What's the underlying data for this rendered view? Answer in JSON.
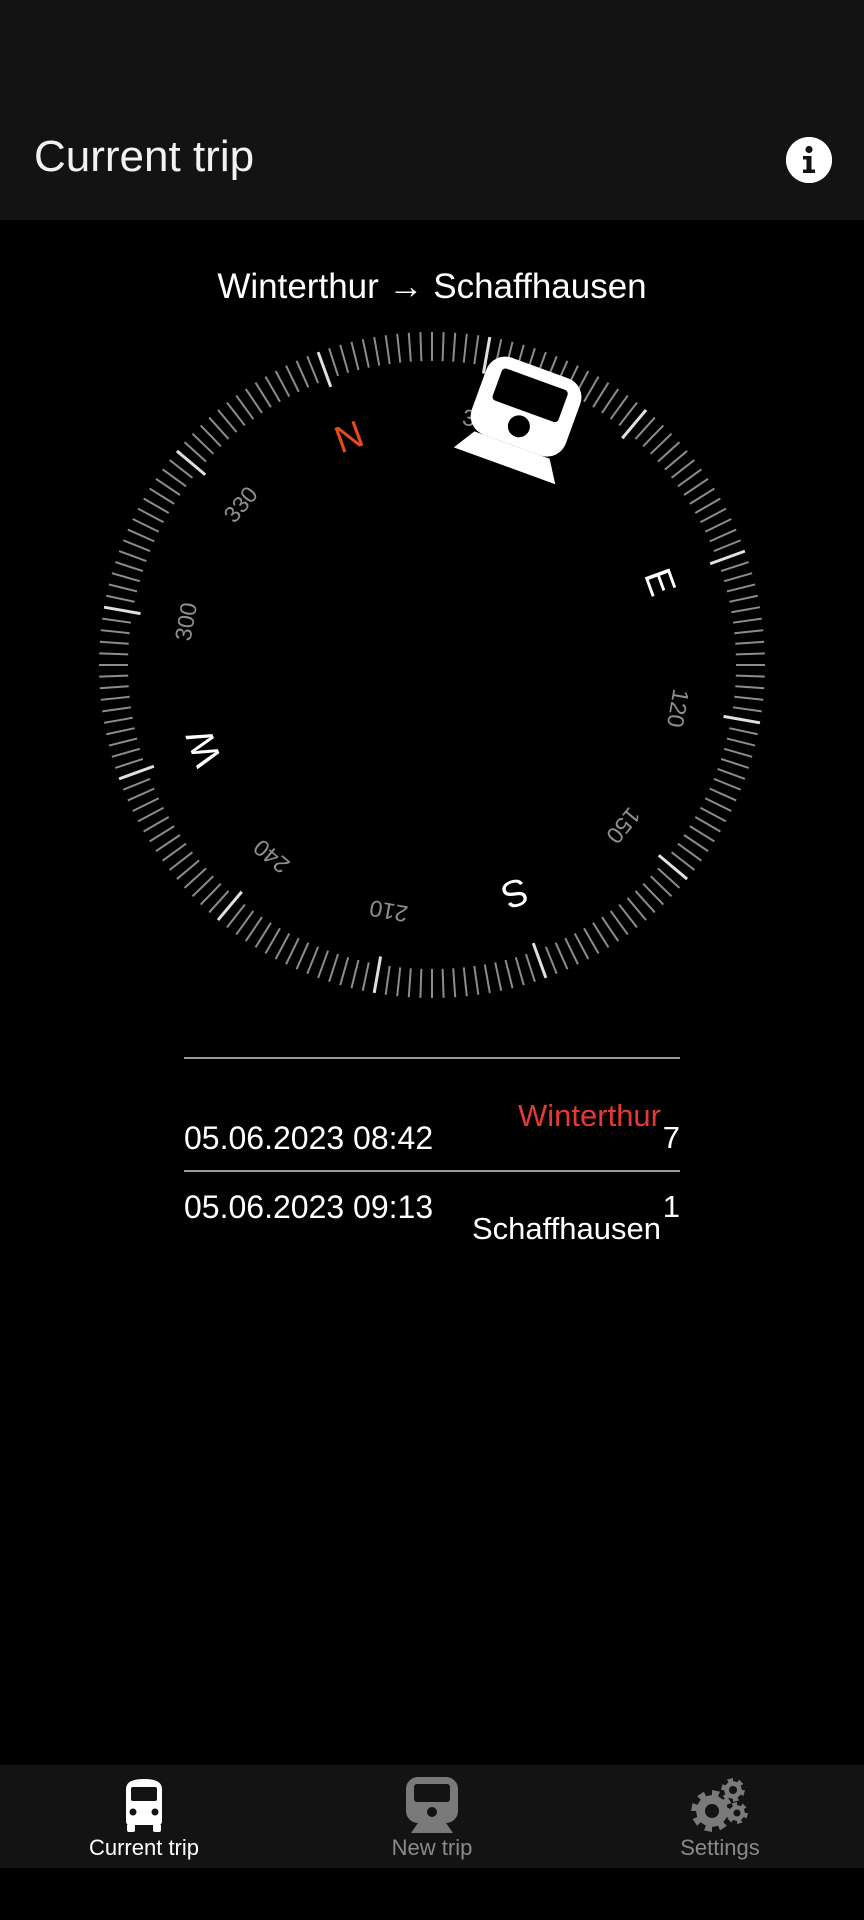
{
  "app_bar": {
    "title": "Current trip",
    "info_icon": "info-icon"
  },
  "trip": {
    "route_title": "Winterthur → Schaffhausen",
    "stops": [
      {
        "time": "05.06.2023 08:42",
        "name": "Winterthur",
        "platform": "7",
        "highlight": true,
        "name_color": "#e53935"
      },
      {
        "time": "05.06.2023 09:13",
        "name": "Schaffhausen",
        "platform": "1",
        "highlight": false,
        "name_color": "#ffffff"
      }
    ]
  },
  "compass": {
    "cardinals": {
      "n": "N",
      "e": "E",
      "s": "S",
      "w": "W"
    },
    "degree_labels": {
      "d30": "30",
      "d120": "120",
      "d150": "150",
      "d210": "210",
      "d240": "240",
      "d300": "300",
      "d330": "330"
    },
    "rotation_deg": -20,
    "train_bearing_deg": 20,
    "north_color": "#e64a19"
  },
  "bottom_nav": {
    "items": [
      {
        "label": "Current trip",
        "icon": "bus-icon",
        "active": true
      },
      {
        "label": "New trip",
        "icon": "train-icon",
        "active": false
      },
      {
        "label": "Settings",
        "icon": "gear-icon",
        "active": false
      }
    ]
  }
}
